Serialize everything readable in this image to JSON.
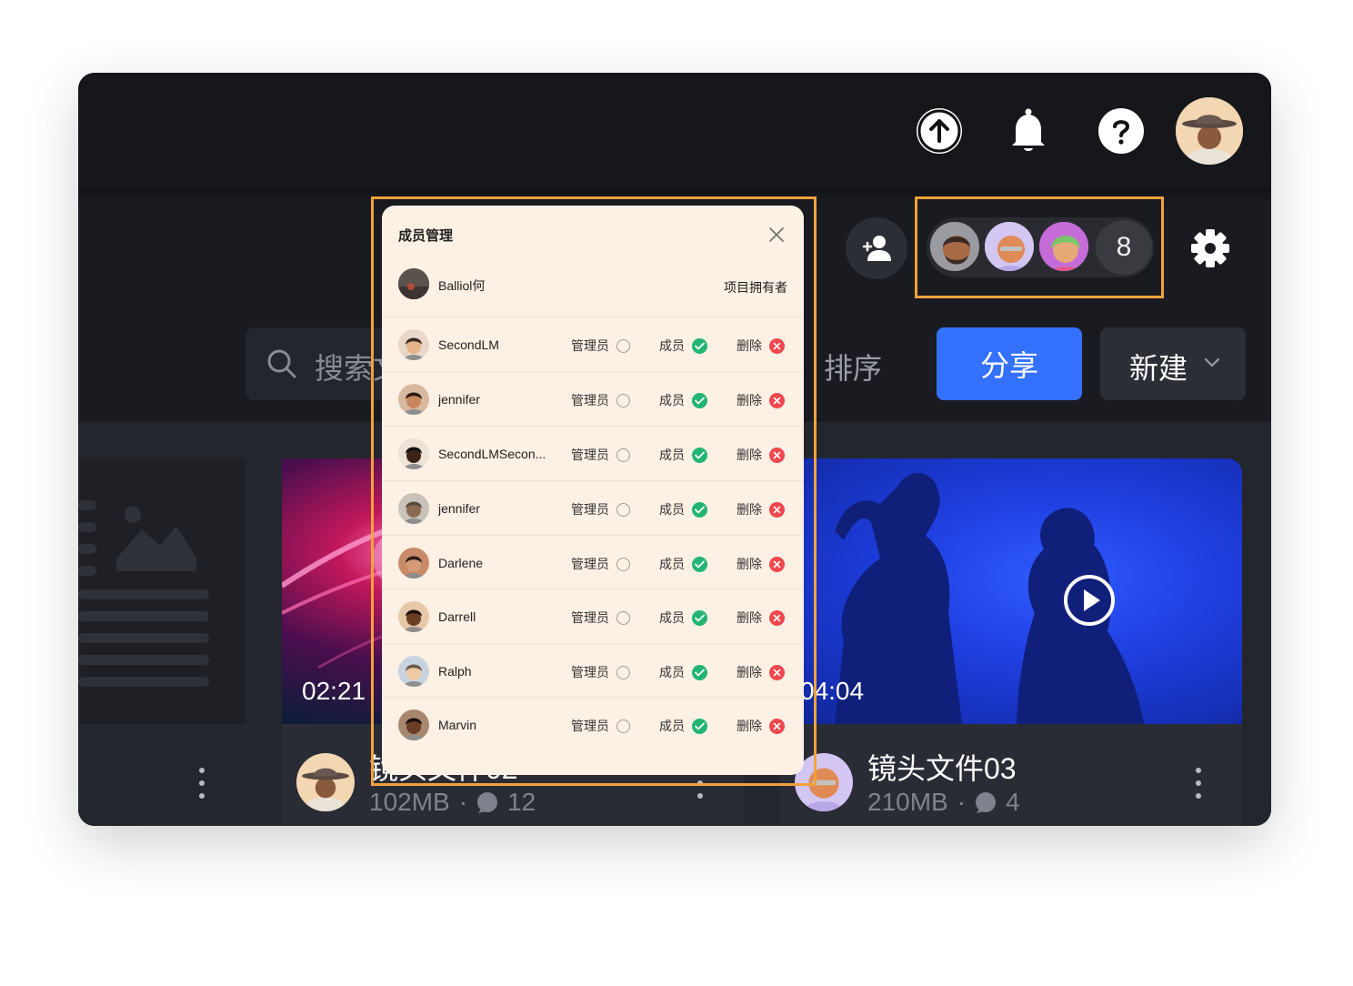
{
  "header": {
    "upload_icon": "upload-icon",
    "bell_icon": "bell-icon",
    "help_icon": "help-icon",
    "user_avatar": "cowboy-hat-avatar"
  },
  "toolbar": {
    "members_count": "8",
    "search_label": "搜索文",
    "sort_label": "排序",
    "share_label": "分享",
    "new_label": "新建"
  },
  "member_panel": {
    "title": "成员管理",
    "owner": {
      "name": "Balliol何",
      "role": "项目拥有者"
    },
    "option_labels": {
      "admin": "管理员",
      "member": "成员",
      "remove": "删除"
    },
    "members": [
      {
        "name": "SecondLM"
      },
      {
        "name": "jennifer"
      },
      {
        "name": "SecondLMSecon..."
      },
      {
        "name": "jennifer"
      },
      {
        "name": "Darlene"
      },
      {
        "name": "Darrell"
      },
      {
        "name": "Ralph"
      },
      {
        "name": "Marvin"
      }
    ]
  },
  "files": [
    {
      "title": "镜头文件02",
      "duration": "02:21",
      "size": "102MB",
      "comments": "12"
    },
    {
      "title": "镜头文件03",
      "duration": "04:04",
      "size": "210MB",
      "comments": "4"
    }
  ],
  "colors": {
    "accent": "#3471ff",
    "highlight_outline": "#f2a23d",
    "panel_bg": "#fdf0e4",
    "check_green": "#22b573",
    "remove_red": "#f0474e"
  }
}
